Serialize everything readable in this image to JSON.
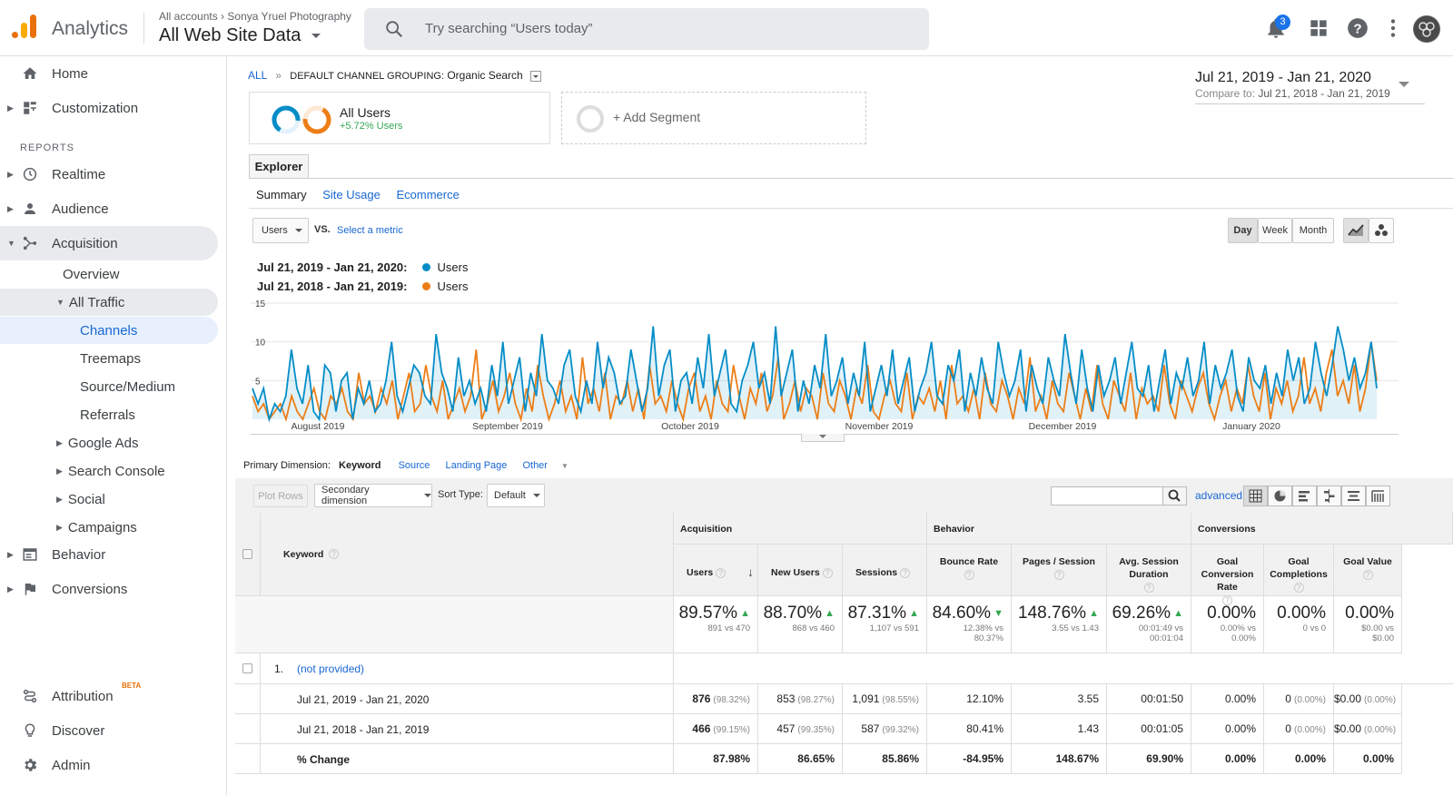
{
  "app": {
    "title": "Analytics",
    "account_breadcrumb": "All accounts",
    "account_name": "Sonya Yruel Photography",
    "property": "All Web Site Data"
  },
  "search": {
    "placeholder": "Try searching “Users today”"
  },
  "topbar": {
    "notification_count": "3"
  },
  "colors": {
    "blue": "#058dc7",
    "orange": "#ed7e17",
    "link": "#1a73e8",
    "selected_bg": "#e8f0fe"
  },
  "sidebar": {
    "home": "Home",
    "customization": "Customization",
    "reports_header": "REPORTS",
    "realtime": "Realtime",
    "audience": "Audience",
    "acquisition": "Acquisition",
    "overview": "Overview",
    "all_traffic": "All Traffic",
    "channels": "Channels",
    "treemaps": "Treemaps",
    "source_medium": "Source/Medium",
    "referrals": "Referrals",
    "google_ads": "Google Ads",
    "search_console": "Search Console",
    "social": "Social",
    "campaigns": "Campaigns",
    "behavior": "Behavior",
    "conversions": "Conversions",
    "attribution": "Attribution",
    "attribution_badge": "BETA",
    "discover": "Discover",
    "admin": "Admin"
  },
  "breadcrumb": {
    "all": "ALL",
    "sep": "»",
    "label": "DEFAULT CHANNEL GROUPING:",
    "value": "Organic Search"
  },
  "daterange": {
    "main": "Jul 21, 2019 - Jan 21, 2020",
    "compare_label": "Compare to:",
    "compare": "Jul 21, 2018 - Jan 21, 2019"
  },
  "segments": {
    "seg1_name": "All Users",
    "seg1_delta": "+5.72% Users",
    "add_segment": "+ Add Segment"
  },
  "explorer": {
    "tab": "Explorer",
    "subtabs": [
      "Summary",
      "Site Usage",
      "Ecommerce"
    ]
  },
  "chart_controls": {
    "metric": "Users",
    "vs": "VS.",
    "select_metric": "Select a metric",
    "day": "Day",
    "week": "Week",
    "month": "Month"
  },
  "legend": {
    "range1": "Jul 21, 2019 - Jan 21, 2020:",
    "range2": "Jul 21, 2018 - Jan 21, 2019:",
    "series": "Users"
  },
  "chart_data": {
    "type": "line",
    "ylim": [
      0,
      15
    ],
    "yticks": [
      "15",
      "10",
      "5"
    ],
    "x_month_labels": [
      "August 2019",
      "September 2019",
      "October 2019",
      "November 2019",
      "December 2019",
      "January 2020"
    ],
    "series": [
      {
        "name": "Users",
        "color": "#058dc7",
        "values": [
          4,
          2,
          4,
          0,
          2,
          1,
          3,
          9,
          4,
          2,
          7,
          1,
          0,
          7,
          6,
          1,
          5,
          6,
          0,
          4,
          2,
          5,
          1,
          2,
          5,
          10,
          3,
          1,
          4,
          7,
          6,
          3,
          2,
          11,
          6,
          4,
          1,
          8,
          3,
          5,
          2,
          4,
          1,
          7,
          3,
          10,
          2,
          5,
          8,
          1,
          6,
          3,
          11,
          5,
          4,
          2,
          7,
          9,
          3,
          1,
          5,
          2,
          10,
          4,
          8,
          6,
          2,
          3,
          9,
          5,
          1,
          4,
          12,
          3,
          7,
          9,
          1,
          5,
          6,
          2,
          8,
          4,
          11,
          3,
          6,
          9,
          2,
          1,
          5,
          7,
          10,
          4,
          6,
          2,
          12,
          3,
          6,
          9,
          1,
          5,
          2,
          7,
          4,
          11,
          3,
          5,
          8,
          2,
          6,
          3,
          10,
          1,
          4,
          7,
          3,
          9,
          2,
          5,
          8,
          1,
          4,
          6,
          10,
          3,
          2,
          7,
          5,
          9,
          1,
          6,
          3,
          8,
          4,
          2,
          10,
          6,
          3,
          5,
          9,
          1,
          7,
          4,
          2,
          8,
          5,
          3,
          11,
          6,
          2,
          9,
          4,
          1,
          7,
          3,
          5,
          8,
          2,
          6,
          10,
          4,
          3,
          7,
          1,
          5,
          9,
          2,
          6,
          4,
          8,
          3,
          5,
          10,
          2,
          7,
          4,
          6,
          9,
          3,
          1,
          8,
          5,
          4,
          7,
          2,
          6,
          3,
          9,
          5,
          8,
          2,
          4,
          10,
          6,
          3,
          7,
          12,
          9,
          5,
          8,
          4,
          6,
          10,
          4
        ]
      },
      {
        "name": "Users",
        "color": "#ed7e17",
        "values": [
          3,
          1,
          2,
          0,
          1,
          2,
          0,
          3,
          1,
          0,
          2,
          4,
          1,
          0,
          3,
          2,
          4,
          1,
          0,
          6,
          2,
          3,
          1,
          4,
          2,
          5,
          0,
          3,
          6,
          1,
          2,
          7,
          3,
          1,
          5,
          0,
          2,
          4,
          1,
          3,
          9,
          0,
          2,
          5,
          1,
          3,
          6,
          2,
          0,
          4,
          1,
          7,
          3,
          0,
          2,
          5,
          1,
          3,
          0,
          8,
          2,
          4,
          1,
          6,
          0,
          3,
          2,
          5,
          1,
          4,
          0,
          7,
          2,
          3,
          1,
          5,
          2,
          0,
          4,
          6,
          1,
          3,
          0,
          5,
          2,
          1,
          7,
          3,
          0,
          4,
          2,
          6,
          1,
          3,
          8,
          0,
          2,
          5,
          1,
          4,
          3,
          0,
          6,
          2,
          1,
          5,
          3,
          0,
          4,
          2,
          7,
          1,
          0,
          3,
          5,
          2,
          1,
          6,
          0,
          3,
          2,
          4,
          1,
          5,
          0,
          7,
          2,
          3,
          1,
          4,
          0,
          6,
          2,
          1,
          5,
          3,
          0,
          4,
          2,
          8,
          1,
          3,
          0,
          5,
          2,
          1,
          6,
          3,
          0,
          4,
          1,
          7,
          2,
          0,
          5,
          3,
          1,
          6,
          0,
          4,
          2,
          3,
          1,
          7,
          2,
          0,
          5,
          3,
          1,
          4,
          6,
          2,
          0,
          3,
          5,
          1,
          4,
          2,
          7,
          3,
          1,
          6,
          0,
          4,
          2,
          5,
          1,
          3,
          8,
          2,
          4,
          1,
          6,
          9,
          3,
          5,
          2,
          7,
          1,
          4,
          10,
          5
        ]
      }
    ]
  },
  "primary_dimension": {
    "label": "Primary Dimension:",
    "keyword": "Keyword",
    "source": "Source",
    "landing_page": "Landing Page",
    "other": "Other"
  },
  "table_toolbar": {
    "plot_rows": "Plot Rows",
    "secondary_dimension": "Secondary dimension",
    "sort_type_label": "Sort Type:",
    "sort_type": "Default",
    "advanced": "advanced"
  },
  "table": {
    "groups": {
      "acquisition": "Acquisition",
      "behavior": "Behavior",
      "conversions": "Conversions"
    },
    "keyword_header": "Keyword",
    "columns": [
      "Users",
      "New Users",
      "Sessions",
      "Bounce Rate",
      "Pages / Session",
      "Avg. Session Duration",
      "Goal Conversion Rate",
      "Goal Completions",
      "Goal Value"
    ],
    "totals": [
      {
        "value": "89.57%",
        "sub": "891 vs 470"
      },
      {
        "value": "88.70%",
        "sub": "868 vs 460"
      },
      {
        "value": "87.31%",
        "sub": "1,107 vs 591"
      },
      {
        "value": "84.60%",
        "sub": "12.38% vs 80.37%"
      },
      {
        "value": "148.76%",
        "sub": "3.55 vs 1.43"
      },
      {
        "value": "69.26%",
        "sub": "00:01:49 vs 00:01:04"
      },
      {
        "value": "0.00%",
        "sub": "0.00% vs 0.00%"
      },
      {
        "value": "0.00%",
        "sub": "0 vs 0"
      },
      {
        "value": "0.00%",
        "sub": "$0.00 vs $0.00"
      }
    ],
    "row_index": "1.",
    "row_keyword": "(not provided)",
    "rows": [
      {
        "label": "Jul 21, 2019 - Jan 21, 2020",
        "cells": [
          [
            "876",
            "(98.32%)"
          ],
          [
            "853",
            "(98.27%)"
          ],
          [
            "1,091",
            "(98.55%)"
          ],
          [
            "12.10%",
            ""
          ],
          [
            "3.55",
            ""
          ],
          [
            "00:01:50",
            ""
          ],
          [
            "0.00%",
            ""
          ],
          [
            "0",
            "(0.00%)"
          ],
          [
            "$0.00",
            "(0.00%)"
          ]
        ]
      },
      {
        "label": "Jul 21, 2018 - Jan 21, 2019",
        "cells": [
          [
            "466",
            "(99.15%)"
          ],
          [
            "457",
            "(99.35%)"
          ],
          [
            "587",
            "(99.32%)"
          ],
          [
            "80.41%",
            ""
          ],
          [
            "1.43",
            ""
          ],
          [
            "00:01:05",
            ""
          ],
          [
            "0.00%",
            ""
          ],
          [
            "0",
            "(0.00%)"
          ],
          [
            "$0.00",
            "(0.00%)"
          ]
        ]
      },
      {
        "label": "% Change",
        "cells": [
          [
            "87.98%",
            ""
          ],
          [
            "86.65%",
            ""
          ],
          [
            "85.86%",
            ""
          ],
          [
            "-84.95%",
            ""
          ],
          [
            "148.67%",
            ""
          ],
          [
            "69.90%",
            ""
          ],
          [
            "0.00%",
            ""
          ],
          [
            "0.00%",
            ""
          ],
          [
            "0.00%",
            ""
          ]
        ]
      }
    ]
  }
}
